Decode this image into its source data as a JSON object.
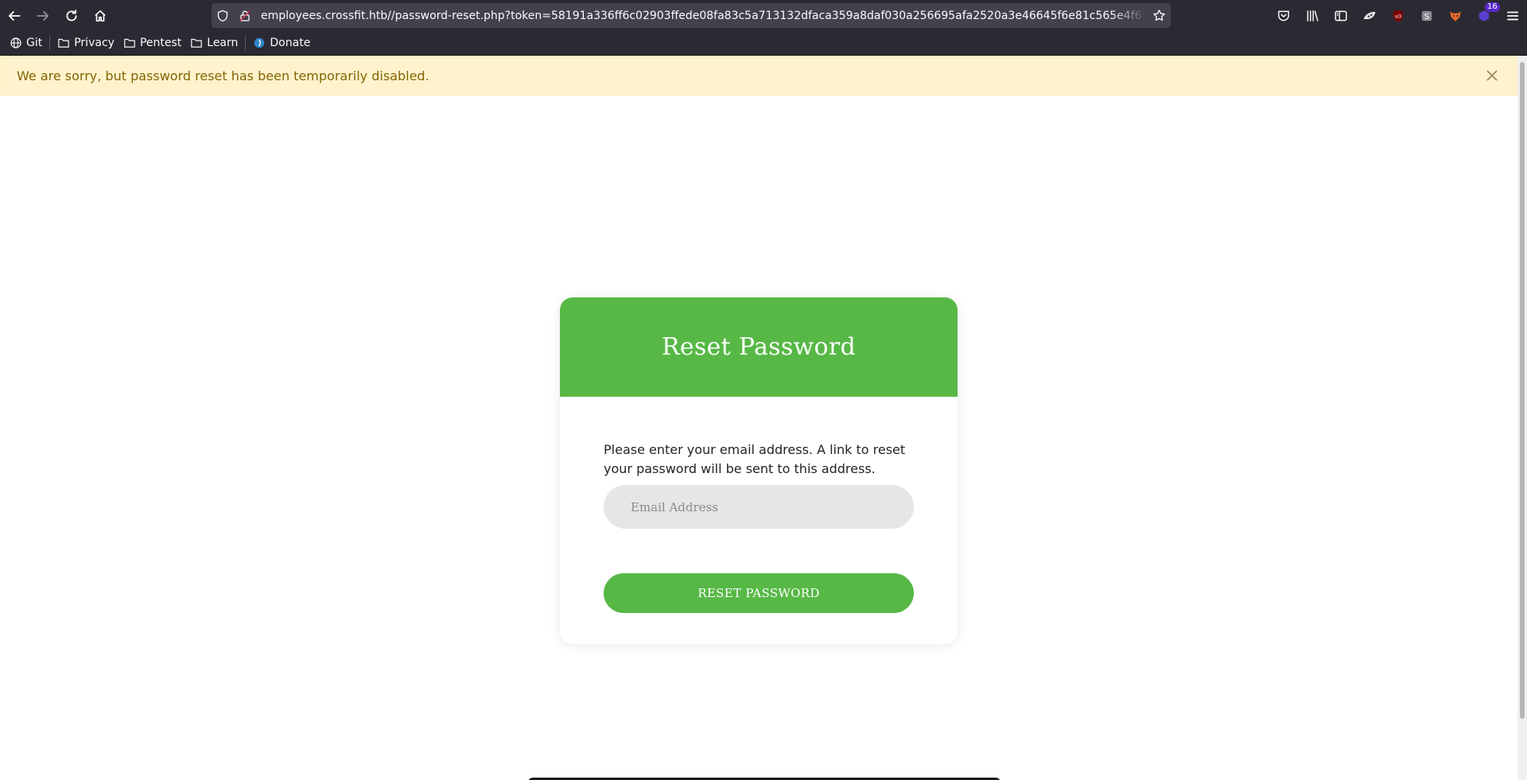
{
  "browser": {
    "url": "employees.crossfit.htb//password-reset.php?token=58191a336ff6c02903ffede08fa83c5a713132dfaca359a8daf030a256695afa2520a3e46645f6e81c565e4f6",
    "notification_badge": "16",
    "bookmarks": [
      {
        "label": "Git",
        "icon": "globe-icon"
      },
      {
        "label": "Privacy",
        "icon": "folder-icon"
      },
      {
        "label": "Pentest",
        "icon": "folder-icon"
      },
      {
        "label": "Learn",
        "icon": "folder-icon"
      },
      {
        "label": "Donate",
        "icon": "donate-icon"
      }
    ]
  },
  "alert": {
    "message": "We are sorry, but password reset has been temporarily disabled."
  },
  "form": {
    "title": "Reset Password",
    "instructions": "Please enter your email address. A link to reset your password will be sent to this address.",
    "email_placeholder": "Email Address",
    "email_value": "",
    "submit_label": "RESET PASSWORD"
  },
  "colors": {
    "accent_green": "#57b846",
    "alert_bg": "#fff3cd",
    "alert_text": "#856404",
    "chrome_bg": "#2b2a33"
  }
}
